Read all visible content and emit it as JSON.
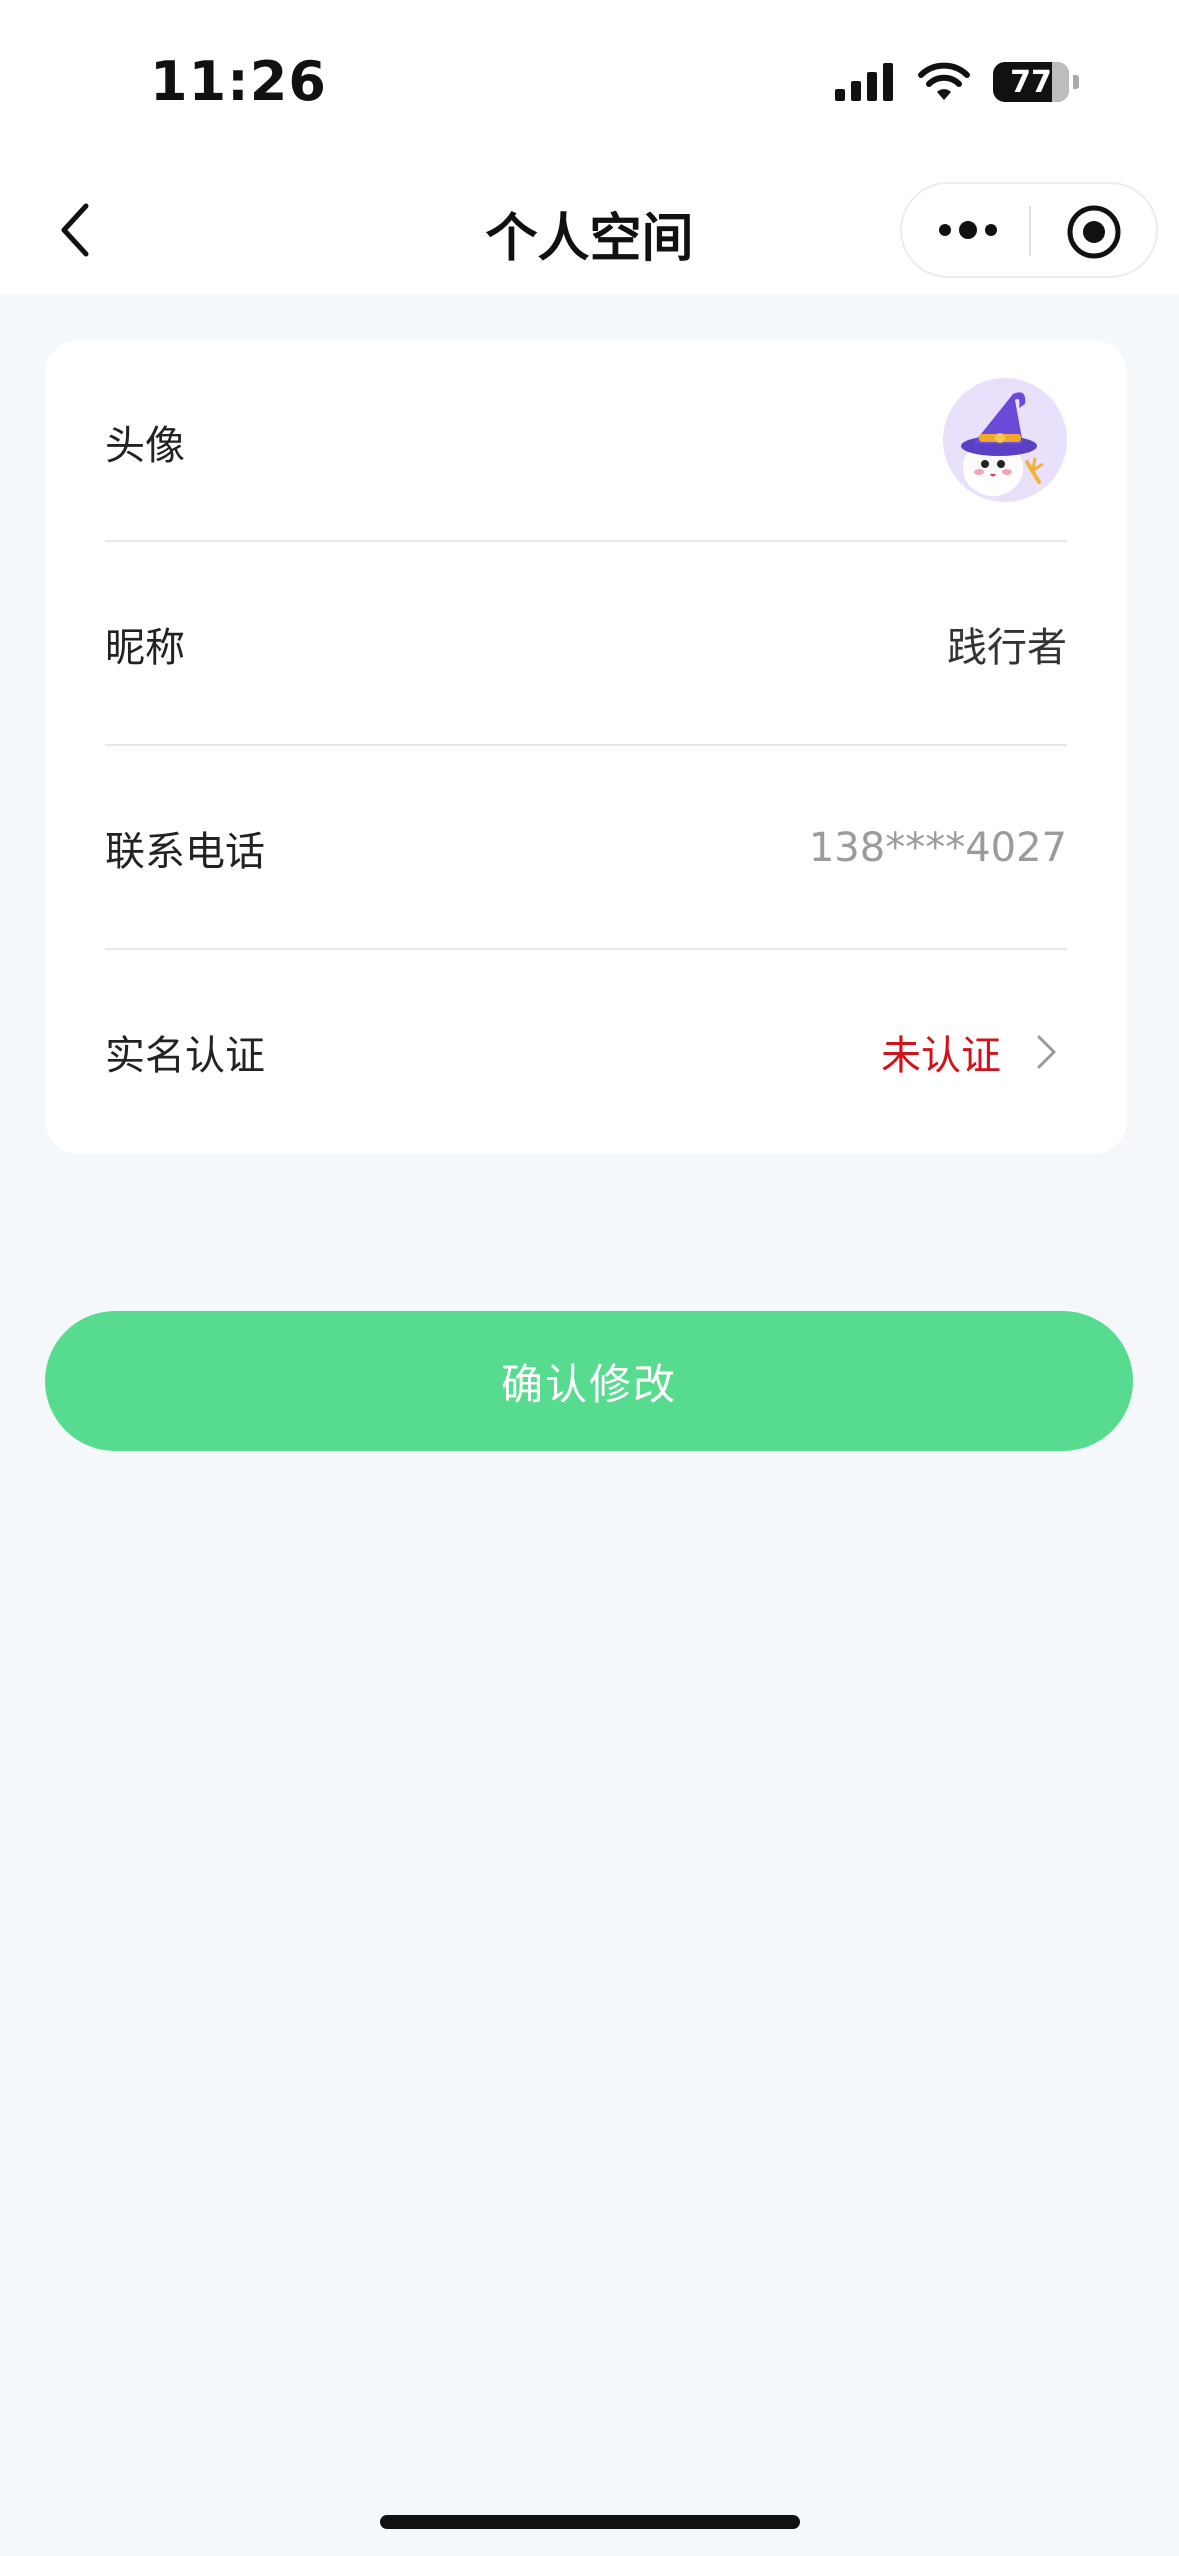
{
  "status_bar": {
    "time": "11:26",
    "battery": "77"
  },
  "nav": {
    "title": "个人空间"
  },
  "profile": {
    "rows": [
      {
        "label": "头像"
      },
      {
        "label": "昵称",
        "value": "践行者"
      },
      {
        "label": "联系电话",
        "value": "138****4027"
      },
      {
        "label": "实名认证",
        "value": "未认证"
      }
    ]
  },
  "actions": {
    "confirm_label": "确认修改"
  },
  "colors": {
    "accent_green": "#57db8e",
    "warning_red": "#d0121b",
    "background": "#f5f8fb"
  },
  "icons": {
    "back": "chevron-left-icon",
    "more": "more-dots-icon",
    "close": "target-close-icon",
    "row_arrow": "chevron-right-icon",
    "avatar": "wizard-avatar-icon"
  }
}
